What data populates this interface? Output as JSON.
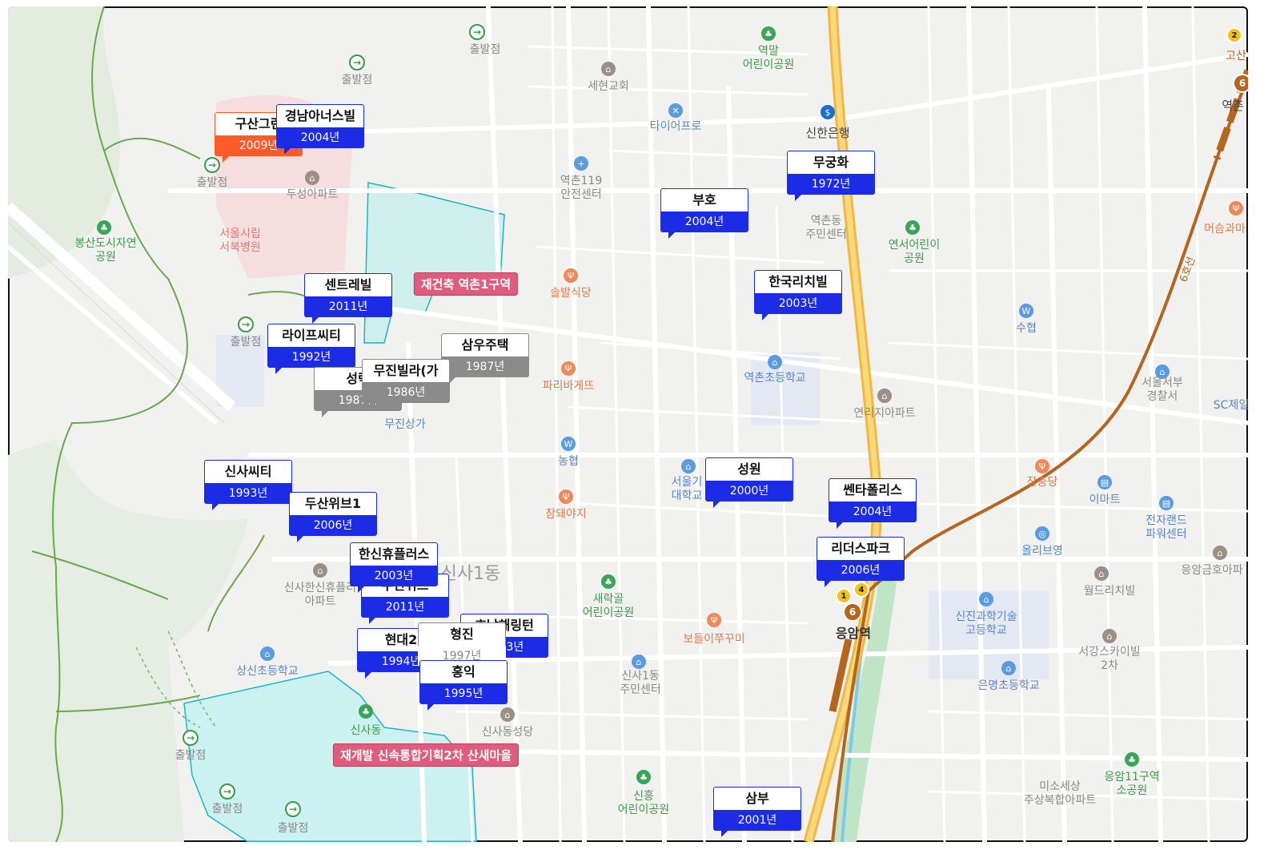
{
  "tags": {
    "rebuild": "재건축 역촌1구역",
    "redevelop": "재개발 신속통합기획2차 산새마을"
  },
  "district": "신사1동",
  "station": "응암역",
  "line6_label": "6호선",
  "subway_badges": {
    "line6": "6",
    "line1": "1",
    "line4": "4",
    "line2": "2"
  },
  "map_labels": {
    "trail_start": "출발점",
    "bongsando": "봉산도시자연\n공원",
    "seobuk_hospital": "서울시립\n서북병원",
    "dusung_apt": "두성아파트",
    "yeokmal_park": "역말\n어린이공원",
    "sehyeon_church": "세현교회",
    "tireprow": "타이어프로",
    "shinhan_bank": "신한은행",
    "yeokchon119": "역촌119\n안전센터",
    "yeokchon_community": "역촌동\n주민센터",
    "yeonseo_park": "연서어린이\n공원",
    "solbal": "솔발식당",
    "suhyup": "수협",
    "meosum": "머슴과마",
    "paris": "파리바게뜨",
    "yeokchon_elem": "역촌초등학교",
    "yeonri_apt": "연리지아파트",
    "police": "서울서부\n경찰서",
    "sc_bank": "SC제일",
    "nonghyup": "농협",
    "seoul_college": "서울기\n대학교",
    "chamdwae": "참돼야지",
    "mujin_sangga": "무진상가",
    "jangchungdang": "장충당",
    "emart": "이마트",
    "electroland": "전자랜드\n파워센터",
    "olive": "올리브영",
    "eungam_apt": "응암금호아파",
    "world_rich": "월드리치빌",
    "sinsa_hanshin": "신사한신휴플러\n아파트",
    "saerakgol_park": "새락골\n어린이공원",
    "bodeul": "보들이쭈꾸미",
    "sinjin_school": "신진과학기술\n고등학교",
    "sangsin_elem": "상신초등학교",
    "sinsa1_community": "신사1동\n주민센터",
    "eunmyeong_elem": "은명초등학교",
    "seogang_sky": "서강스카이빌\n2차",
    "sinsadong": "신사동",
    "sinsa_church": "신사동성당",
    "sinheung_park": "신흥\n어린이공원",
    "miso": "미소세상\n주상복합아파트",
    "eungam11_park": "응암11구역\n소공원",
    "yeokchon_east": "역촌",
    "gosan": "고산"
  },
  "markers": [
    {
      "name": "구산그린",
      "year": "2009년",
      "color": "orange"
    },
    {
      "name": "경남아너스빌",
      "year": "2004년",
      "color": "blue"
    },
    {
      "name": "무궁화",
      "year": "1972년",
      "color": "blue"
    },
    {
      "name": "부호",
      "year": "2004년",
      "color": "blue"
    },
    {
      "name": "센트레빌",
      "year": "2011년",
      "color": "blue"
    },
    {
      "name": "한국리치빌",
      "year": "2003년",
      "color": "blue"
    },
    {
      "name": "라이프씨티",
      "year": "1992년",
      "color": "blue"
    },
    {
      "name": "삼우주택",
      "year": "1987년",
      "color": "gray"
    },
    {
      "name": "성락",
      "year": "1987년",
      "color": "gray"
    },
    {
      "name": "무진빌라(가",
      "year": "1986년",
      "color": "gray"
    },
    {
      "name": "신사씨티",
      "year": "1993년",
      "color": "blue"
    },
    {
      "name": "성원",
      "year": "2000년",
      "color": "blue"
    },
    {
      "name": "두산위브1",
      "year": "2006년",
      "color": "blue"
    },
    {
      "name": "쎈타폴리스",
      "year": "2004년",
      "color": "blue"
    },
    {
      "name": "한신휴플러스",
      "year": "2003년",
      "color": "blue"
    },
    {
      "name": "리더스파크",
      "year": "2006년",
      "color": "blue"
    },
    {
      "name": "우민위브",
      "year": "2011년",
      "color": "blue"
    },
    {
      "name": "호남해링턴",
      "year": "2003년",
      "color": "blue"
    },
    {
      "name": "현대2",
      "year": "1994년",
      "color": "blue"
    },
    {
      "name": "형진",
      "year": "1997년",
      "color": "white"
    },
    {
      "name": "홍익",
      "year": "1995년",
      "color": "blue"
    },
    {
      "name": "삼부",
      "year": "2001년",
      "color": "blue"
    }
  ]
}
